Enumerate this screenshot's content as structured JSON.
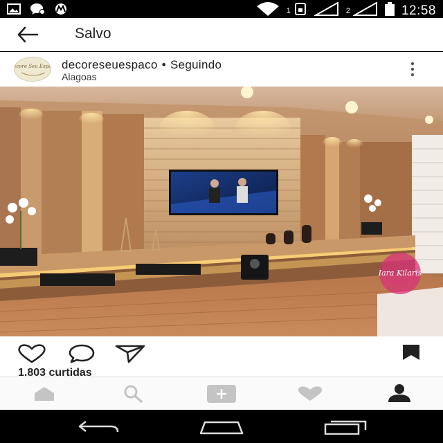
{
  "status_bar": {
    "sim1": "1",
    "sim2": "2",
    "time": "12:58",
    "icons": [
      "image-icon",
      "messenger-icon",
      "motorola-icon",
      "wifi-icon",
      "signal-icon",
      "battery-icon"
    ]
  },
  "header": {
    "back_icon": "arrow-left-icon",
    "title": "Salvo"
  },
  "post": {
    "username": "decoreseuespaco",
    "separator": "•",
    "follow_status": "Seguindo",
    "location": "Alagoas",
    "avatar_text": "Decore Seu Espaço",
    "watermark": "Iara Kilaris",
    "likes": "1.803 curtidas"
  },
  "actions": {
    "icons": [
      "heart-icon",
      "comment-icon",
      "share-icon",
      "bookmark-icon"
    ]
  },
  "nav": {
    "icons": [
      "home-icon",
      "search-icon",
      "add-icon",
      "activity-icon",
      "profile-icon"
    ]
  },
  "android_nav": {
    "icons": [
      "back-icon",
      "home-icon",
      "recents-icon"
    ]
  },
  "colors": {
    "nav_inactive": "#c4c4c4",
    "icon_dark": "#222222",
    "wood": "#b07a4e",
    "light_glow": "#f5c466"
  }
}
